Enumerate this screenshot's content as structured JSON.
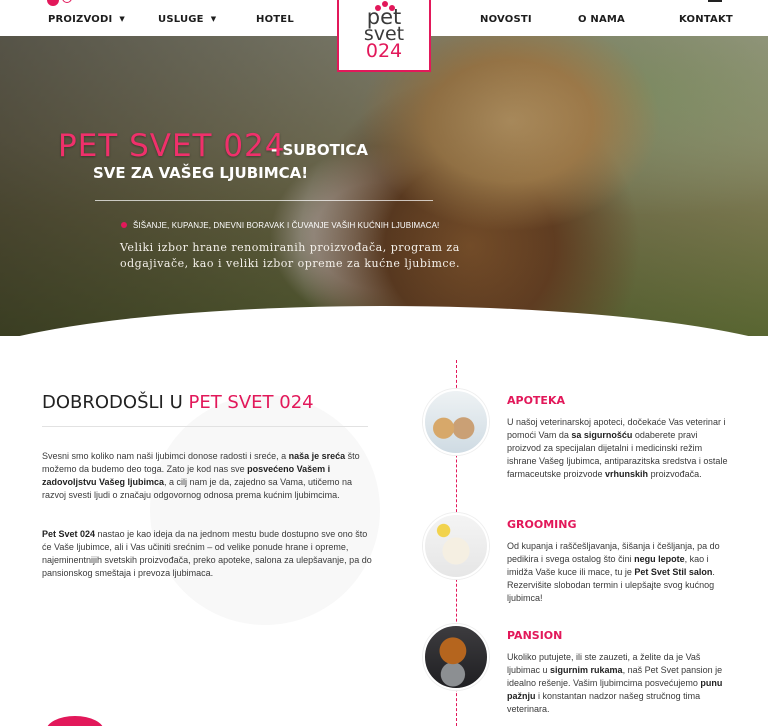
{
  "nav": {
    "items": [
      {
        "label": "PROIZVODI",
        "dropdown": true
      },
      {
        "label": "USLUGE",
        "dropdown": true
      },
      {
        "label": "HOTEL",
        "dropdown": false
      },
      {
        "label": "NOVOSTI",
        "dropdown": false
      },
      {
        "label": "O NAMA",
        "dropdown": false
      },
      {
        "label": "KONTAKT",
        "dropdown": false
      }
    ],
    "caret": "▼"
  },
  "logo": {
    "line1": "pet",
    "line2": "svet",
    "line3": "024"
  },
  "hero": {
    "title": "PET SVET 024",
    "suffix": "- SUBOTICA",
    "tagline": "SVE ZA VAŠEG LJUBIMCA!",
    "bullet": "ŠIŠANJE, KUPANJE, DNEVNI BORAVAK I ČUVANJE VAŠIH KUĆNIH LJUBIMACA!",
    "description": "Veliki izbor hrane renomiranih proizvođača, program za odgajivače, kao i veliki izbor opreme za kućne ljubimce."
  },
  "welcome": {
    "title_prefix": "DOBRODOŠLI U",
    "title_accent": "PET SVET 024",
    "p1": {
      "a": "Svesni smo koliko nam naši ljubimci donose radosti i sreće, a ",
      "b1": "naša je sreća",
      "c": " što možemo da budemo deo toga. Zato je kod nas sve ",
      "b2": "posvećeno Vašem i zadovoljstvu Vašeg ljubimca",
      "d": ", a cilj nam je da, zajedno sa Vama, utičemo na razvoj svesti ljudi o značaju odgovornog odnosa prema kućnim ljubimcima."
    },
    "p2": {
      "b1": "Pet Svet 024",
      "a": " nastao je kao ideja da na jednom mestu bude dostupno sve ono što će Vaše ljubimce, ali i Vas učiniti srećnim – od velike ponude hrane i opreme, najeminentnijih svetskih proizvođača, preko apoteke, salona za ulepšavanje, pa do pansionskog smeštaja i prevoza ljubimaca."
    }
  },
  "services": {
    "apoteka": {
      "title": "APOTEKA",
      "a": "U našoj veterinarskoj apoteci, dočekaće Vas veterinar i pomoći Vam da ",
      "b1": "sa sigurnošću",
      "c": " odaberete pravi proizvod za specijalan dijetalni i medicinski režim ishrane Vašeg ljubimca, antiparazitska sredstva i ostale farmaceutske proizvode ",
      "b2": "vrhunskih",
      "d": " proizvođača."
    },
    "grooming": {
      "title": "GROOMING",
      "a": "Od kupanja i raščešljavanja, šišanja i češljanja, pa do pedikira i svega ostalog što čini ",
      "b1": "negu lepote",
      "c": ", kao i imidža Vaše kuce ili mace, tu je ",
      "b2": "Pet Svet Stil salon",
      "d": ". Rezervišite slobodan termin i ulepšajte svog kućnog ljubimca!"
    },
    "pansion": {
      "title": "PANSION",
      "a": "Ukoliko putujete, ili ste zauzeti, a želite da je Vaš ljubimac u ",
      "b1": "sigurnim rukama",
      "c": ", naš Pet Svet pansion je idealno rešenje. Vašim ljubimcima posvećujemo ",
      "b2": "punu pažnju",
      "d": " i konstantan nadzor našeg stručnog tima veterinara."
    }
  },
  "colors": {
    "accent": "#e2185a",
    "text": "#333333"
  }
}
